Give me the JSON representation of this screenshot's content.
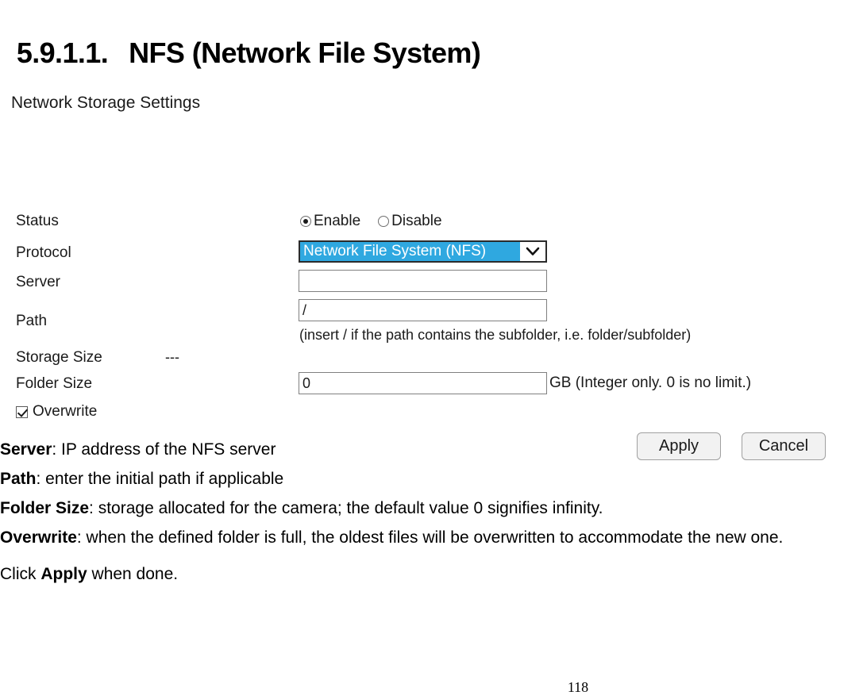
{
  "heading": {
    "number": "5.9.1.1.",
    "title": "NFS (Network File System)"
  },
  "settings_panel": {
    "title": "Network Storage Settings",
    "labels": {
      "status": "Status",
      "protocol": "Protocol",
      "server": "Server",
      "path": "Path",
      "storage_size": "Storage Size",
      "folder_size": "Folder Size",
      "overwrite": "Overwrite"
    },
    "status": {
      "enable_label": "Enable",
      "disable_label": "Disable",
      "selected": "Enable"
    },
    "protocol": {
      "selected_option": "Network File System (NFS)",
      "options": [
        "Network File System (NFS)"
      ],
      "highlight_color": "#2fa8e0",
      "arrow_icon": "chevron-down-icon"
    },
    "server": {
      "value": "",
      "placeholder": ""
    },
    "path": {
      "value": "/",
      "hint": "(insert / if the path contains the subfolder, i.e. folder/subfolder)"
    },
    "storage_size": {
      "value": "---"
    },
    "folder_size": {
      "value": "0",
      "suffix": "GB (Integer only. 0 is no limit.)"
    },
    "overwrite": {
      "checked": true
    },
    "buttons": {
      "apply": "Apply",
      "cancel": "Cancel"
    }
  },
  "notes": [
    {
      "term": "Server",
      "text": ": IP address of the NFS server"
    },
    {
      "term": "Path",
      "text": ": enter the initial path if applicable"
    },
    {
      "term": "Folder Size",
      "text": ": storage allocated for the camera; the default value 0 signifies infinity."
    },
    {
      "term": "Overwrite",
      "text": ": when the defined folder is full, the oldest files will be overwritten to accommodate the new one."
    }
  ],
  "closing": {
    "prefix": "Click ",
    "bold": "Apply",
    "suffix": " when done."
  },
  "page_number": "118"
}
